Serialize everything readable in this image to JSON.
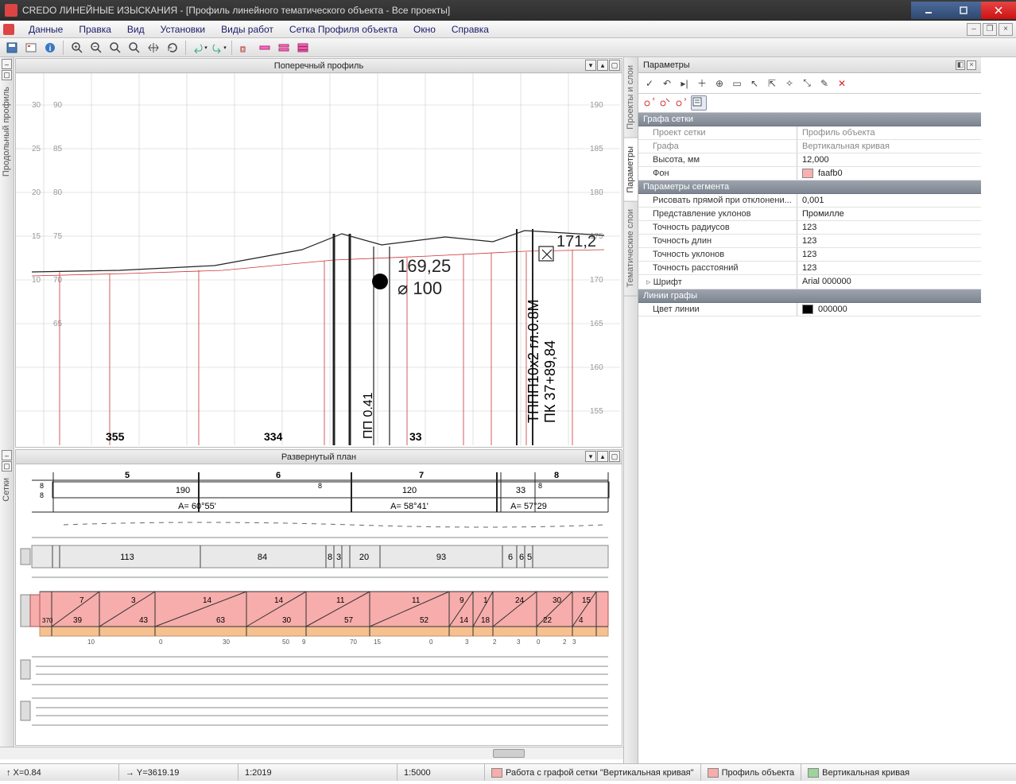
{
  "title": "CREDO ЛИНЕЙНЫЕ ИЗЫСКАНИЯ - [Профиль линейного тематического объекта - Все проекты]",
  "menu": [
    "Данные",
    "Правка",
    "Вид",
    "Установки",
    "Виды работ",
    "Сетка Профиля объекта",
    "Окно",
    "Справка"
  ],
  "left": {
    "profile_title": "Поперечный профиль",
    "plan_title": "Развернутый план",
    "side_labels": [
      "Продольный профиль",
      "Сетки"
    ],
    "profile_annots": {
      "h_value": "169,25",
      "dia_value": "⌀ 100",
      "right_value": "171,2",
      "vert_text1": "ТППП10х2 гл.0.8М",
      "vert_text2": "ПК 37+89,84",
      "vert_text3": "ПП 0.41",
      "left_labels": [
        "355",
        "334"
      ],
      "yticks_left": [
        "30",
        "25",
        "20",
        "15",
        "10"
      ],
      "yticks_right": [
        "190",
        "185",
        "180",
        "175",
        "170",
        "165",
        "160",
        "155"
      ]
    },
    "plan_rows": {
      "header_nums": [
        "5",
        "6",
        "7",
        "8"
      ],
      "row1": {
        "cells": [
          "190",
          "120",
          "33"
        ],
        "angles": [
          "A= 60°55'",
          "A= 58°41'",
          "A= 57°29"
        ],
        "lmarks": [
          "8",
          "8"
        ]
      },
      "row2": {
        "cells": [
          "113",
          "84",
          "8",
          "3",
          "20",
          "93",
          "6",
          "6",
          "5"
        ]
      },
      "row3": {
        "tri_top": [
          "7",
          "3",
          "14",
          "14",
          "11",
          "11",
          "9",
          "1",
          "24",
          "30",
          "15"
        ],
        "tri_bot": [
          "39",
          "43",
          "63",
          "30",
          "57",
          "52",
          "14",
          "18",
          "22",
          "4"
        ],
        "lmark": "370"
      },
      "row3_axis": [
        "10",
        "0",
        "30",
        "50",
        "9",
        "70",
        "15",
        "0",
        "3",
        "2",
        "3",
        "0",
        "2",
        "3"
      ]
    }
  },
  "right": {
    "title": "Параметры",
    "tabs": [
      "Проекты и слои",
      "Параметры",
      "Тематические слои"
    ],
    "active_tab": 1,
    "grid": {
      "g1": {
        "header": "Графа сетки",
        "rows": [
          {
            "n": "Проект сетки",
            "v": "Профиль объекта",
            "dim": true
          },
          {
            "n": "Графа",
            "v": "Вертикальная кривая",
            "dim": true
          },
          {
            "n": "Высота, мм",
            "v": "12,000"
          },
          {
            "n": "Фон",
            "v": "faafb0",
            "color": "#faafb0"
          }
        ]
      },
      "g2": {
        "header": "Параметры сегмента",
        "rows": [
          {
            "n": "Рисовать прямой при отклонени...",
            "v": "0,001"
          },
          {
            "n": "Представление уклонов",
            "v": "Промилле"
          },
          {
            "n": "Точность радиусов",
            "v": "123"
          },
          {
            "n": "Точность длин",
            "v": "123"
          },
          {
            "n": "Точность уклонов",
            "v": "123"
          },
          {
            "n": "Точность расстояний",
            "v": "123"
          },
          {
            "n": "Шрифт",
            "v": "Arial 000000",
            "expand": true
          }
        ]
      },
      "g3": {
        "header": "Линии графы",
        "rows": [
          {
            "n": "Цвет линии",
            "v": "000000",
            "color": "#000000"
          }
        ]
      }
    }
  },
  "status": {
    "x": "↑ X=0.84",
    "y": "→ Y=3619.19",
    "s1": "1:2019",
    "s2": "1:5000",
    "t1": "Работа с графой сетки \"Вертикальная кривая\"",
    "t2": "Профиль объекта",
    "t3": "Вертикальная кривая"
  }
}
